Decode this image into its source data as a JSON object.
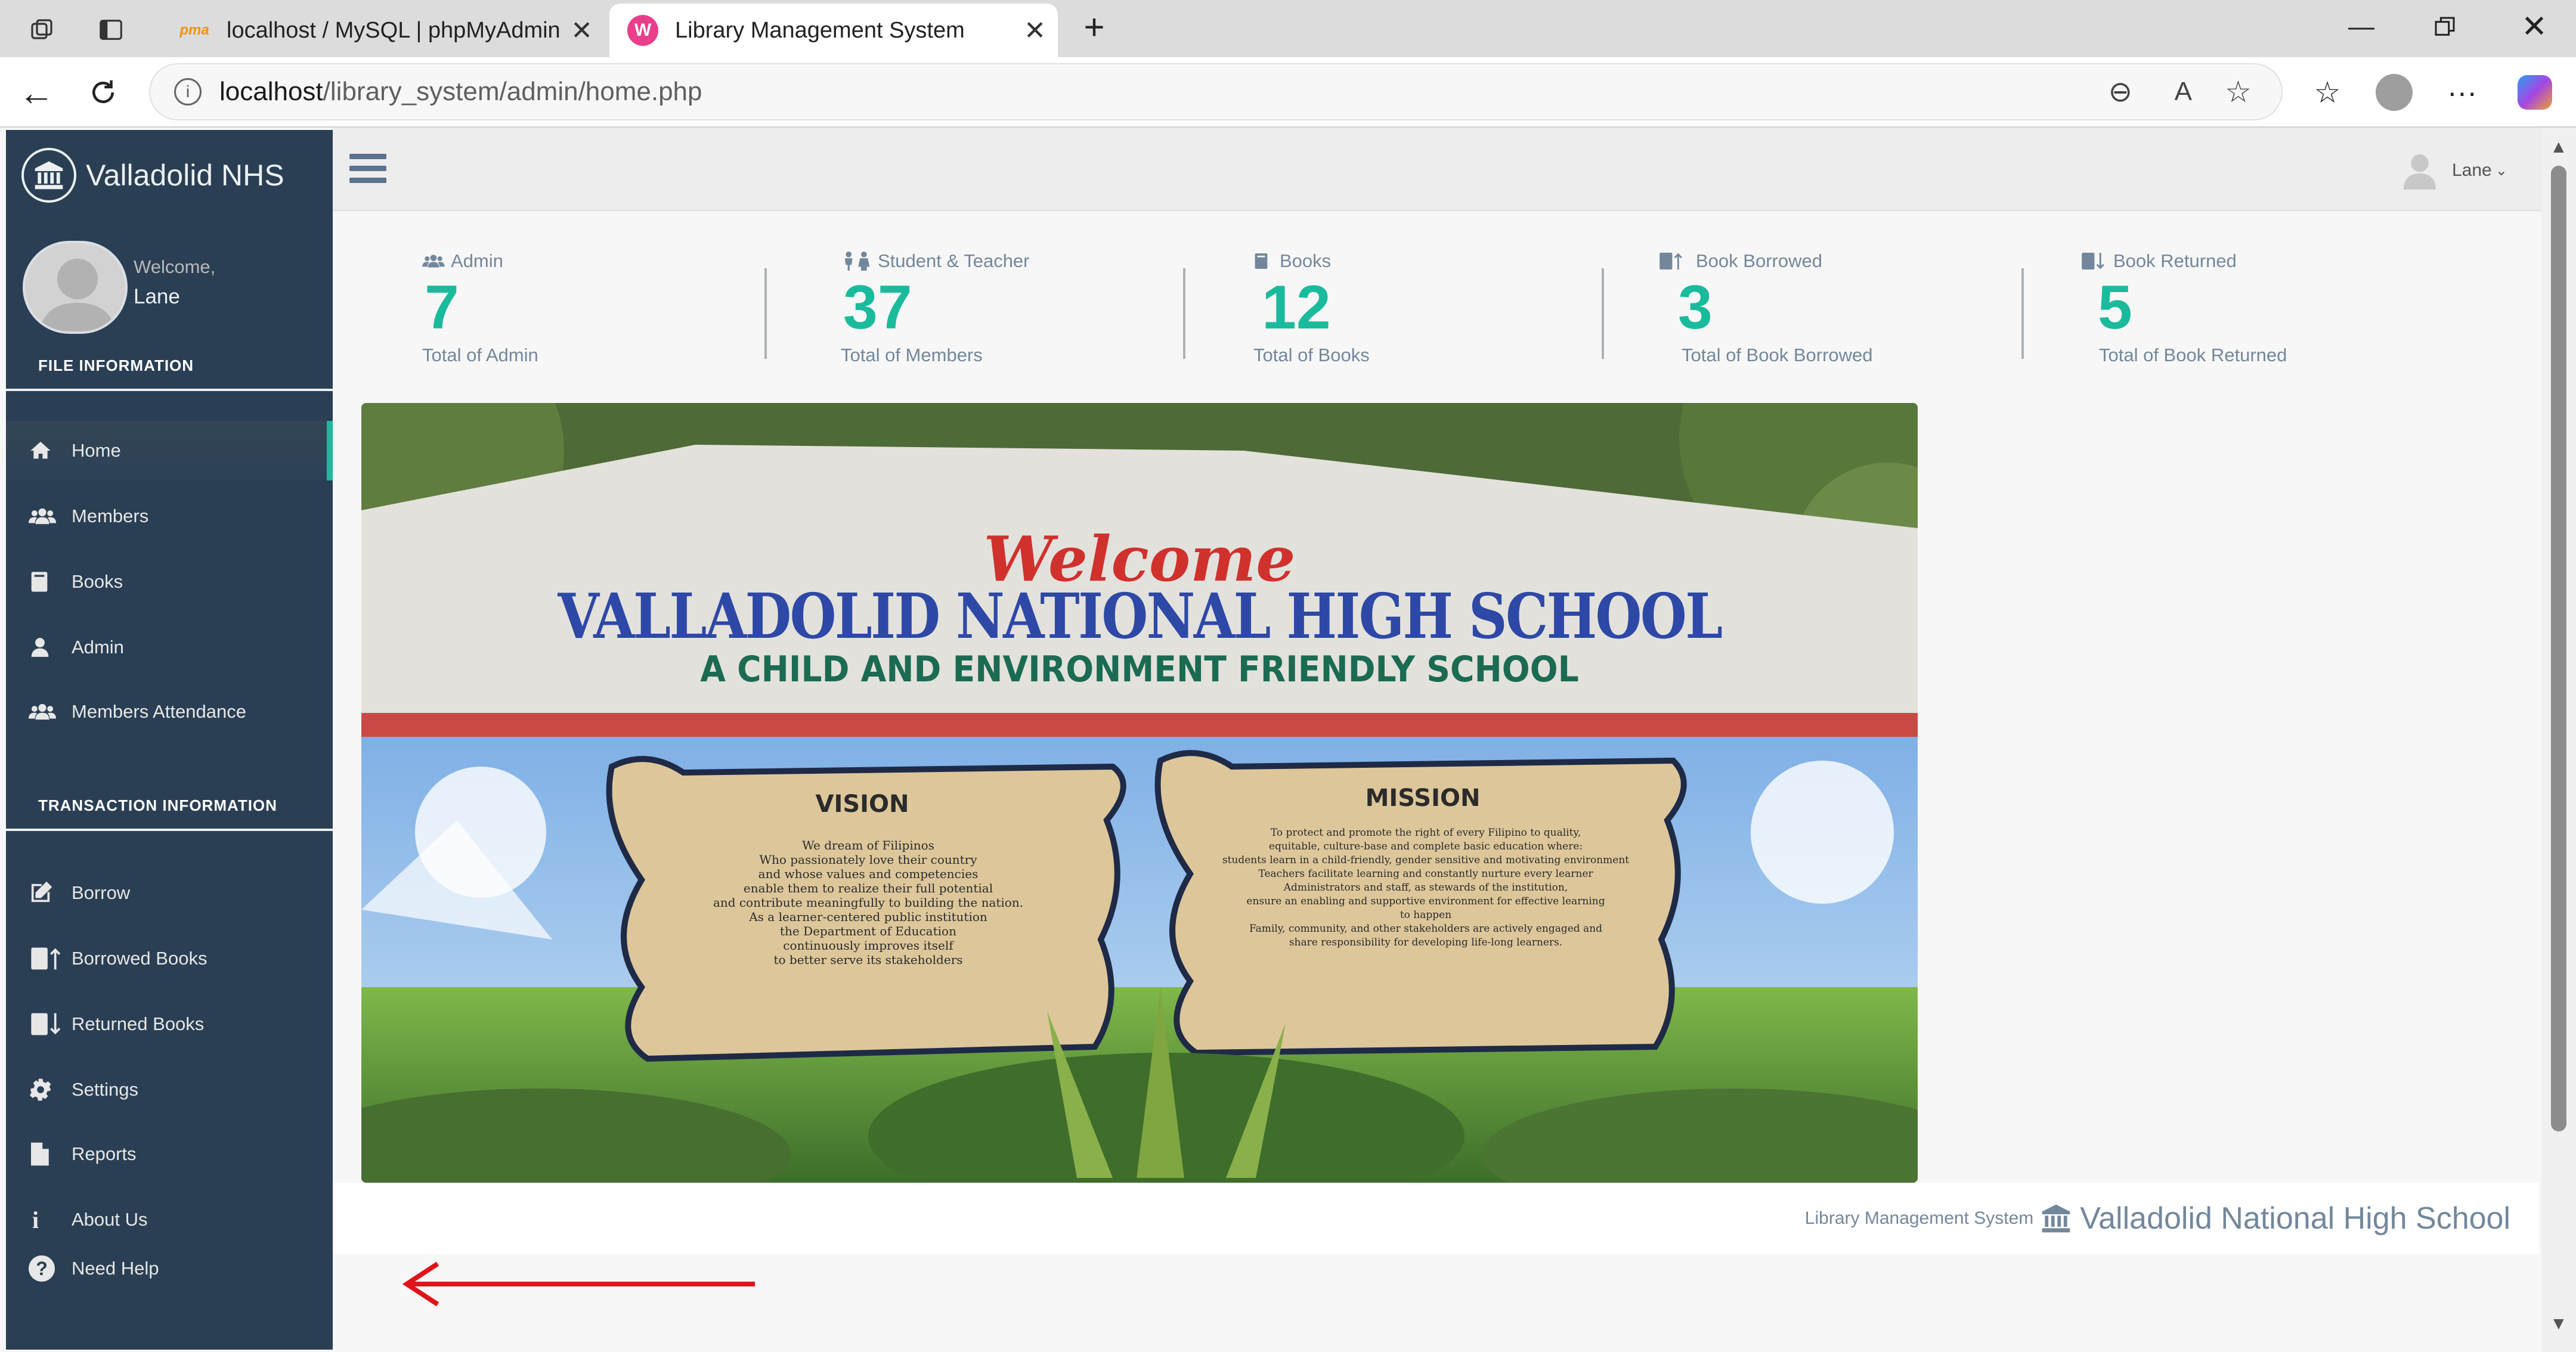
{
  "browser": {
    "tabs": [
      {
        "title": "localhost / MySQL | phpMyAdmin",
        "favicon": "phpmyadmin-icon",
        "active": false
      },
      {
        "title": "Library Management System",
        "favicon": "library-app-icon",
        "active": true
      }
    ],
    "url_host": "localhost",
    "url_path": "/library_system/admin/home.php"
  },
  "sidebar": {
    "brand": "Valladolid NHS",
    "welcome": "Welcome,",
    "user": "Lane",
    "file_section": "FILE INFORMATION",
    "file_items": [
      {
        "label": "Home",
        "icon": "home-icon"
      },
      {
        "label": "Members",
        "icon": "users-icon"
      },
      {
        "label": "Books",
        "icon": "book-icon"
      },
      {
        "label": "Admin",
        "icon": "user-icon"
      },
      {
        "label": "Members Attendance",
        "icon": "users-icon"
      }
    ],
    "transaction_section": "TRANSACTION INFORMATION",
    "transaction_items": [
      {
        "label": "Borrow",
        "icon": "edit-icon"
      },
      {
        "label": "Borrowed Books",
        "icon": "book-up-icon"
      },
      {
        "label": "Returned Books",
        "icon": "book-down-icon"
      },
      {
        "label": "Settings",
        "icon": "gear-icon"
      },
      {
        "label": "Reports",
        "icon": "file-icon"
      },
      {
        "label": "About Us",
        "icon": "info-icon"
      },
      {
        "label": "Need Help",
        "icon": "help-icon"
      }
    ]
  },
  "topnav": {
    "user": "Lane"
  },
  "stats": [
    {
      "label": "Admin",
      "count": "7",
      "sub": "Total of Admin",
      "icon": "users-icon"
    },
    {
      "label": "Student & Teacher",
      "count": "37",
      "sub": "Total of Members",
      "icon": "people-icon"
    },
    {
      "label": "Books",
      "count": "12",
      "sub": "Total of Books",
      "icon": "book-icon"
    },
    {
      "label": "Book Borrowed",
      "count": "3",
      "sub": "Total of Book Borrowed",
      "icon": "book-up-icon"
    },
    {
      "label": "Book Returned",
      "count": "5",
      "sub": "Total of Book Returned",
      "icon": "book-down-icon"
    }
  ],
  "hero": {
    "welcome": "Welcome",
    "school": "VALLADOLID NATIONAL HIGH SCHOOL",
    "tagline": "A CHILD AND ENVIRONMENT FRIENDLY SCHOOL",
    "vision_title": "VISION",
    "vision_lines": [
      "We dream of Filipinos",
      "Who passionately love their country",
      "and whose values and competencies",
      "enable them to realize their full potential",
      "and contribute meaningfully to building the nation.",
      "As a learner-centered public institution",
      "the Department of Education",
      "continuously improves itself",
      "to better serve its stakeholders"
    ],
    "mission_title": "MISSION",
    "mission_lines": [
      "To protect and promote the right of every Filipino to quality,",
      "equitable, culture-base and complete basic education where:",
      "students learn in a child-friendly, gender sensitive and motivating environment",
      "Teachers facilitate learning and constantly nurture every learner",
      "Administrators and staff, as stewards of the institution,",
      "ensure an enabling and supportive environment for effective learning",
      "to happen",
      "Family, community, and other stakeholders are actively engaged and",
      "share responsibility for developing life-long learners."
    ]
  },
  "footer": {
    "small": "Library Management System",
    "big": "Valladolid National High School"
  },
  "colors": {
    "sidebar": "#2a3f54",
    "accent": "#1abb9c",
    "arrow": "#e0131a"
  }
}
